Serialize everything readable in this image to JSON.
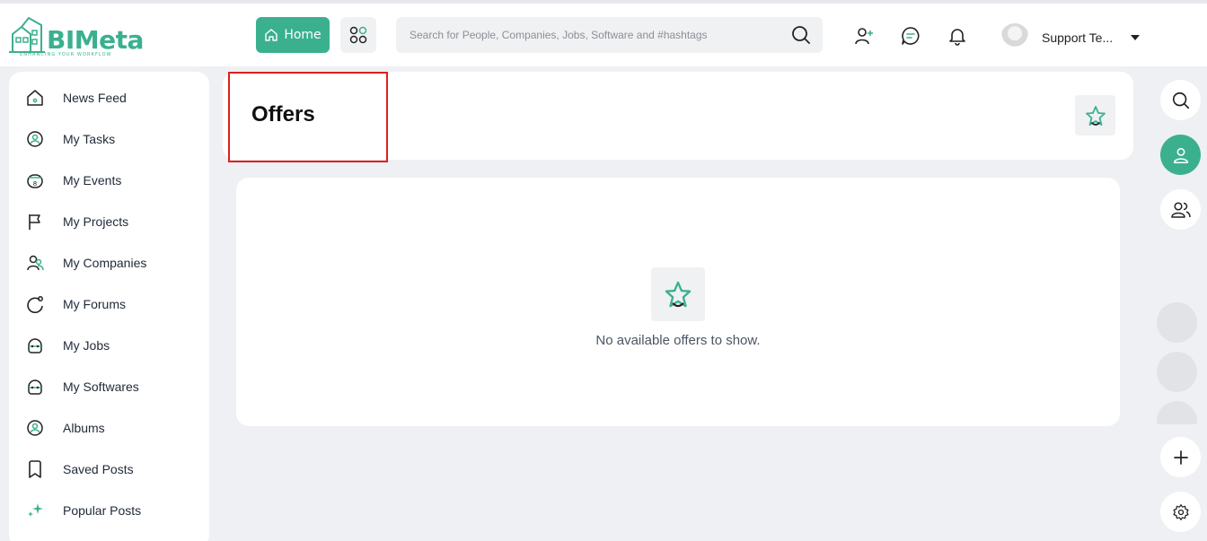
{
  "brand": {
    "name": "BIMeta",
    "tagline": "ENHANCING YOUR WORKFLOW",
    "accent": "#3bb08f"
  },
  "topbar": {
    "home_label": "Home",
    "search_placeholder": "Search for People, Companies, Jobs, Software and #hashtags",
    "user_name": "Support Te...",
    "icons": [
      "home-icon",
      "apps-grid-icon",
      "search-icon",
      "add-user-icon",
      "chat-icon",
      "bell-icon",
      "caret-down-icon"
    ]
  },
  "sidebar": {
    "items": [
      {
        "label": "News Feed",
        "icon": "home-icon"
      },
      {
        "label": "My Tasks",
        "icon": "task-icon"
      },
      {
        "label": "My Events",
        "icon": "calendar-icon"
      },
      {
        "label": "My Projects",
        "icon": "flag-icon"
      },
      {
        "label": "My Companies",
        "icon": "companies-icon"
      },
      {
        "label": "My Forums",
        "icon": "forum-icon"
      },
      {
        "label": "My Jobs",
        "icon": "briefcase-icon"
      },
      {
        "label": "My Softwares",
        "icon": "software-icon"
      },
      {
        "label": "Albums",
        "icon": "album-icon"
      },
      {
        "label": "Saved Posts",
        "icon": "bookmark-icon"
      },
      {
        "label": "Popular Posts",
        "icon": "sparkle-icon"
      }
    ]
  },
  "page": {
    "title": "Offers",
    "empty_message": "No available offers to show."
  },
  "rail": {
    "icons": [
      "search-icon",
      "user-icon",
      "users-icon",
      "plus-icon",
      "settings-icon"
    ]
  }
}
